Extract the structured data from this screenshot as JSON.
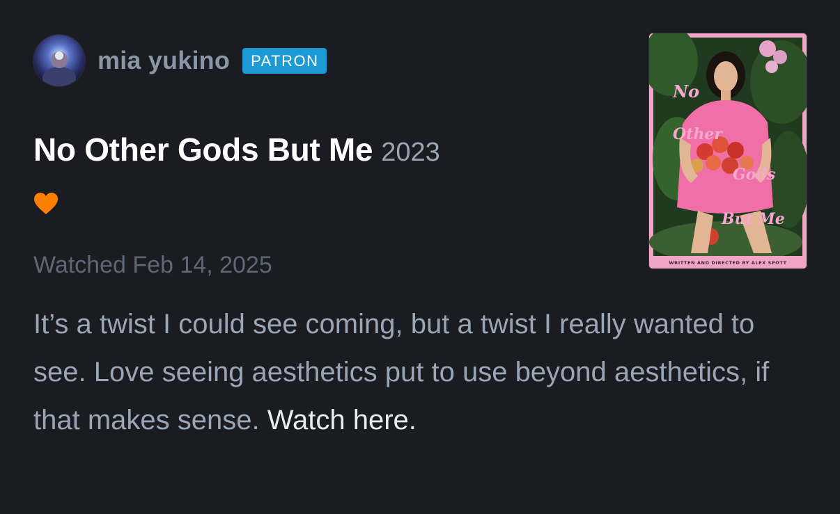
{
  "user": {
    "name": "mia yukino",
    "badge": "PATRON"
  },
  "film": {
    "title": "No Other Gods But Me",
    "year": "2023",
    "liked": true
  },
  "watched_label": "Watched Feb 14, 2025",
  "review": {
    "text": "It’s a twist I could see coming, but a twist I really wanted to see. Love seeing aesthetics put to use beyond aesthetics, if that makes sense. ",
    "link_text": "Watch here."
  },
  "poster": {
    "title_words": [
      "No",
      "Other",
      "Gods",
      "But Me"
    ],
    "credit": "WRITTEN AND DIRECTED BY ALEX SPOTT"
  },
  "colors": {
    "background": "#1a1c21",
    "badge": "#1b9ad6",
    "heart": "#ff8000",
    "poster_frame": "#f2a4c8"
  },
  "icons": {
    "like": "heart-icon"
  }
}
